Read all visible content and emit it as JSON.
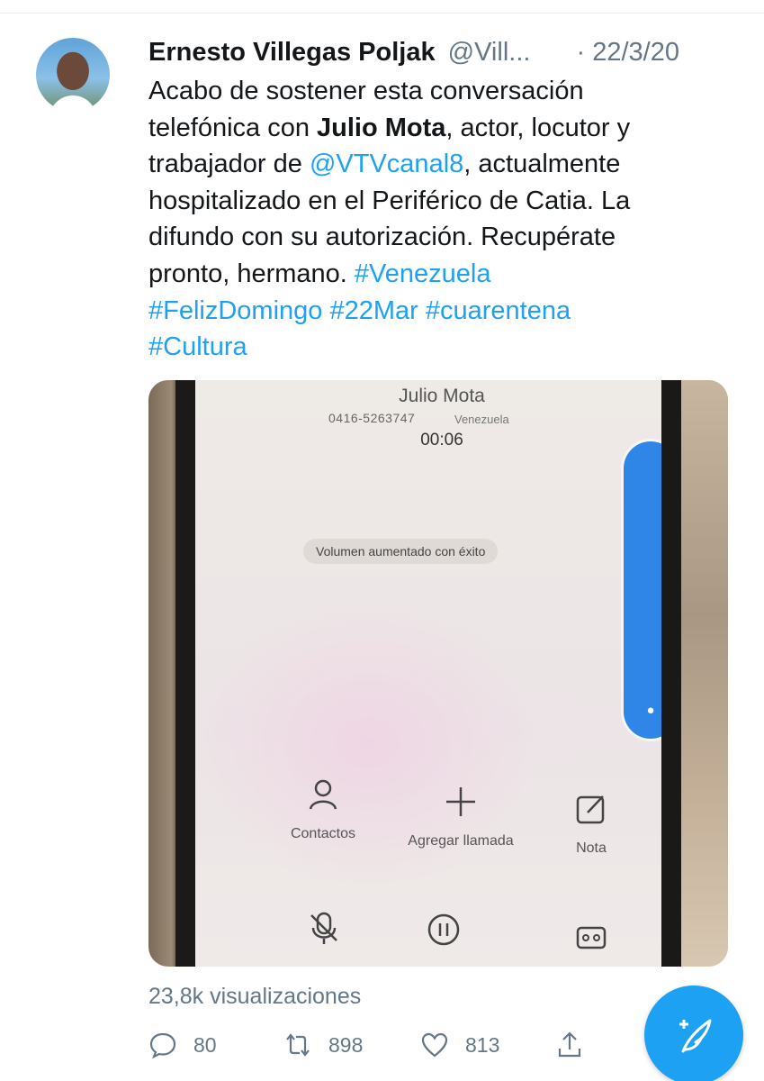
{
  "tweet": {
    "author_name": "Ernesto Villegas Poljak",
    "author_handle": "@Vill...",
    "date": "· 22/3/20",
    "text": {
      "line1": "Acabo de sostener esta conversación",
      "line2_pre": "telefónica con ",
      "line2_bold": "Julio Mota",
      "line2_post": ", actor, locutor y",
      "line3_pre": "trabajador de ",
      "line3_mention": "@VTVcanal8",
      "line3_post": ", actualmente",
      "line4": "hospitalizado en el Periférico de Catia. La",
      "line5": "difundo con su autorización. Recupérate",
      "line6_pre": "pronto, hermano. ",
      "hashtag_venezuela": "#Venezuela",
      "hashtag_felizdomingo": "#FelizDomingo",
      "hashtag_22mar": "#22Mar",
      "hashtag_cuarentena": "#cuarentena",
      "hashtag_cultura": "#Cultura"
    },
    "views": "23,8k visualizaciones",
    "counts": {
      "replies": "80",
      "retweets": "898",
      "likes": "813"
    }
  },
  "media": {
    "call_name": "Julio Mota",
    "call_number": "0416-5263747",
    "call_country": "Venezuela",
    "call_timer": "00:06",
    "toast": "Volumen aumentado con éxito",
    "actions": {
      "contacts": "Contactos",
      "add_call": "Agregar llamada",
      "note": "Nota",
      "mute": "Silenciar",
      "hold": "Espera"
    }
  },
  "colors": {
    "accent": "#1da1f2",
    "text_secondary": "#657786",
    "volume_blue": "#2f86e6"
  },
  "icons": [
    "reply-icon",
    "retweet-icon",
    "like-icon",
    "share-icon",
    "compose-tweet-icon"
  ]
}
